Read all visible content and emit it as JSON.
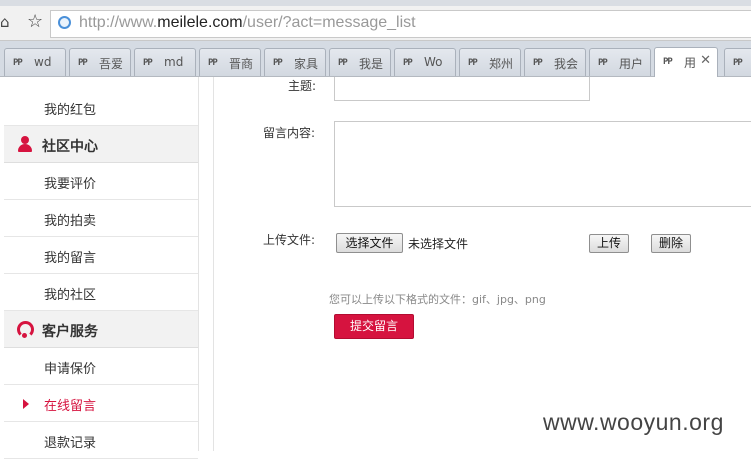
{
  "browser": {
    "url_prefix": "http://www.",
    "url_domain": "meilele.com",
    "url_path": "/user/?act=message_list",
    "tabs": [
      {
        "title": "wd",
        "icon": "favicon-pp-icon"
      },
      {
        "title": "吾爱",
        "icon": "favicon-pp-icon"
      },
      {
        "title": "md",
        "icon": "favicon-pp-icon"
      },
      {
        "title": "晋商",
        "icon": "favicon-pp-icon"
      },
      {
        "title": "家具",
        "icon": "favicon-pp-icon"
      },
      {
        "title": "我是",
        "icon": "favicon-pp-icon"
      },
      {
        "title": "Wo",
        "icon": "favicon-pp-icon"
      },
      {
        "title": "郑州",
        "icon": "favicon-pp-icon"
      },
      {
        "title": "我会",
        "icon": "favicon-pp-icon"
      },
      {
        "title": "用户",
        "icon": "favicon-pp-icon"
      },
      {
        "title": "用",
        "icon": "favicon-pp-icon",
        "active": true
      }
    ],
    "tab_close": "✕"
  },
  "sidebar": {
    "items": [
      {
        "label": "我的红包",
        "type": "link"
      },
      {
        "label": "社区中心",
        "type": "header",
        "icon": "user-icon"
      },
      {
        "label": "我要评价",
        "type": "link"
      },
      {
        "label": "我的拍卖",
        "type": "link"
      },
      {
        "label": "我的留言",
        "type": "link"
      },
      {
        "label": "我的社区",
        "type": "link"
      },
      {
        "label": "客户服务",
        "type": "header",
        "icon": "headset-icon"
      },
      {
        "label": "申请保价",
        "type": "link"
      },
      {
        "label": "在线留言",
        "type": "link",
        "active": true
      },
      {
        "label": "退款记录",
        "type": "link"
      }
    ]
  },
  "form": {
    "subject_label": "主题:",
    "content_label": "留言内容:",
    "upload_label": "上传文件:",
    "choose_file_button": "选择文件",
    "no_file_text": "未选择文件",
    "upload_button": "上传",
    "delete_button": "删除",
    "hint": "您可以上传以下格式的文件：gif、jpg、png",
    "submit_button": "提交留言"
  },
  "watermark": "www.wooyun.org",
  "colors": {
    "accent": "#d6133f"
  }
}
